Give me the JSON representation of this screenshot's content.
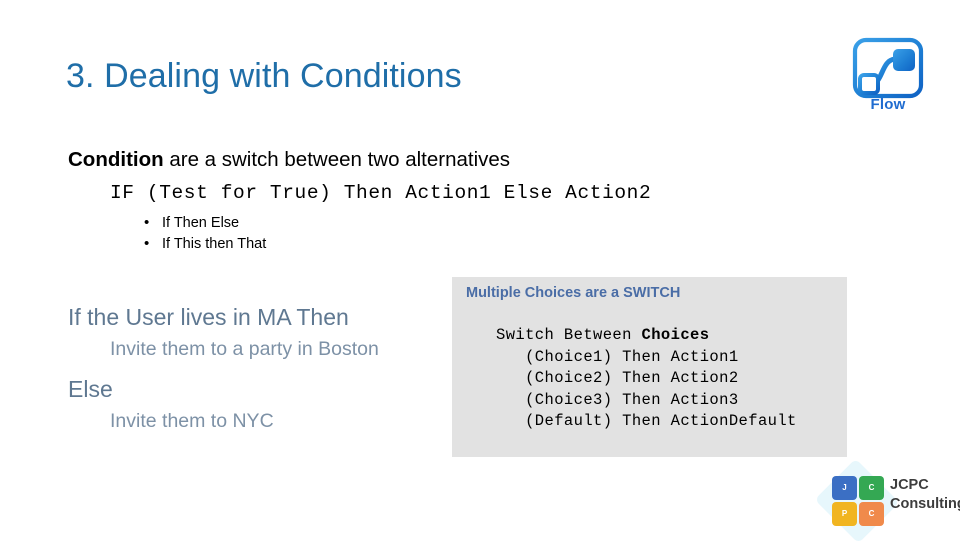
{
  "slide": {
    "title": "3. Dealing with Conditions",
    "lead": {
      "strong": "Condition",
      "rest": " are a switch between two alternatives"
    },
    "code_line": "IF (Test for True) Then Action1 Else Action2",
    "bullets": [
      "If Then Else",
      "If This then That"
    ],
    "pseudo_code": {
      "if_line": "If the User lives in MA Then",
      "if_body": "Invite them to a party in Boston",
      "else_line": "Else",
      "else_body": "Invite them to NYC"
    },
    "switch_panel": {
      "heading": "Multiple Choices are a SWITCH",
      "code_head_prefix": "Switch Between ",
      "code_head_bold": "Choices",
      "code_lines": [
        "   (Choice1) Then Action1",
        "   (Choice2) Then Action2",
        "   (Choice3) Then Action3",
        "   (Default) Then ActionDefault"
      ]
    }
  },
  "flow_logo": {
    "icon": "flow-logo-icon",
    "label": "Flow",
    "color": "#1f6cd0"
  },
  "jcpc_logo": {
    "icon": "jcpc-tiles-icon",
    "tiles": [
      {
        "letter": "J",
        "color": "#3b6fc4"
      },
      {
        "letter": "C",
        "color": "#34a853"
      },
      {
        "letter": "P",
        "color": "#f1b521"
      },
      {
        "letter": "C",
        "color": "#f08a4b"
      }
    ],
    "line1": "JCPC",
    "line2": "Consulting"
  },
  "colors": {
    "title_blue": "#1f6ea8",
    "panel_bg": "#e2e2e2",
    "panel_heading": "#4a6da6",
    "pseudo_keyword": "#5f7891",
    "pseudo_body": "#7d91a6"
  }
}
